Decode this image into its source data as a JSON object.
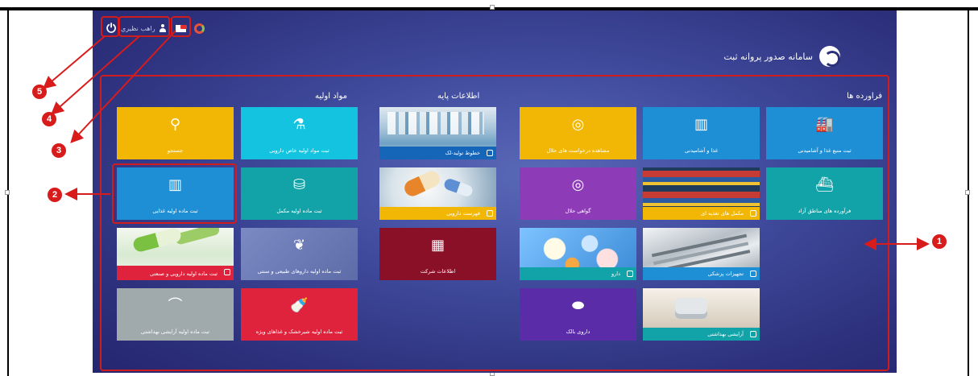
{
  "header": {
    "user_name": "راهب نظيري",
    "power_icon": "power-icon",
    "user_icon": "user-icon",
    "mail_icon": "mail-icon",
    "logo_icon": "ttac-logo-icon"
  },
  "brand": {
    "title": "سامانه صدور پروانه ثبت"
  },
  "sections": {
    "products": "فراورده ها",
    "base_info": "اطلاعات پایه",
    "raw_materials": "مواد اولیه"
  },
  "tiles": {
    "food_source": "ثبت منبع غذا و آشامیدنی",
    "food_drink": "غذا و آشامیدنی",
    "halal_requests": "مشاهده درخواست های حلال",
    "production_lines": "خطوط تولید-لک",
    "pharma_special_raw": "ثبت مواد اولیه خاص دارویی",
    "search": "جستجو",
    "free_zone": "فرآورده های مناطق آزاد",
    "supplements": "مکمل های تغذیه ای",
    "halal_cert": "گواهی حلال",
    "drug_list": "فهرست دارویی",
    "supplement_raw": "ثبت ماده اولیه مکمل",
    "food_raw": "ثبت ماده اولیه غذایی",
    "medical_equipment": "تجهیزات پزشکی",
    "drug": "دارو",
    "company_info": "اطلاعات شرکت",
    "herbal_raw": "ثبت ماده اولیه داروهای طبیعی و سنتی",
    "industrial_raw": "ثبت ماده اولیه دارویی و صنعتی",
    "cosmetics": "آرایشی بهداشتی",
    "bulk_drug": "داروی بالک",
    "milk_special_raw": "ثبت ماده اولیه شیرخشک و غذاهای ویژه",
    "cosmetic_raw": "ثبت ماده اولیه آرایشی بهداشتی"
  },
  "callouts": [
    "1",
    "2",
    "3",
    "4",
    "5"
  ],
  "colors": {
    "accent_red": "#d81b1b",
    "tile_blue": "#1e8fd5",
    "tile_teal": "#12a3a8",
    "tile_yellow": "#f2b705",
    "tile_purple": "#8e3bb8",
    "tile_cyan": "#14c3e0",
    "tile_maroon": "#8a1027",
    "tile_red": "#e0233c",
    "tile_gray": "#a0a9ab",
    "tile_indigo": "#5b2ca8"
  }
}
